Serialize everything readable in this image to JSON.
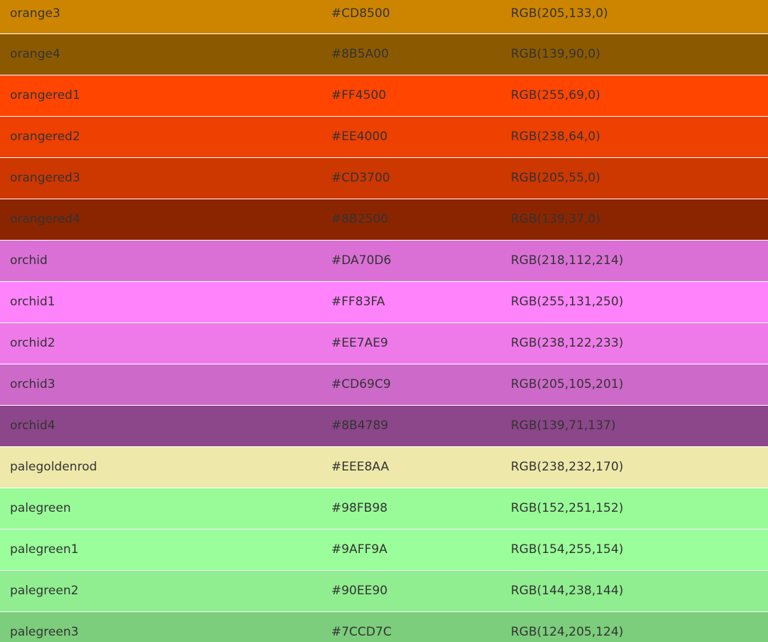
{
  "rows": [
    {
      "name": "orange3",
      "hex": "#CD8500",
      "rgb": "RGB(205,133,0)"
    },
    {
      "name": "orange4",
      "hex": "#8B5A00",
      "rgb": "RGB(139,90,0)"
    },
    {
      "name": "orangered1",
      "hex": "#FF4500",
      "rgb": "RGB(255,69,0)"
    },
    {
      "name": "orangered2",
      "hex": "#EE4000",
      "rgb": "RGB(238,64,0)"
    },
    {
      "name": "orangered3",
      "hex": "#CD3700",
      "rgb": "RGB(205,55,0)"
    },
    {
      "name": "orangered4",
      "hex": "#8B2500",
      "rgb": "RGB(139,37,0)"
    },
    {
      "name": "orchid",
      "hex": "#DA70D6",
      "rgb": "RGB(218,112,214)"
    },
    {
      "name": "orchid1",
      "hex": "#FF83FA",
      "rgb": "RGB(255,131,250)"
    },
    {
      "name": "orchid2",
      "hex": "#EE7AE9",
      "rgb": "RGB(238,122,233)"
    },
    {
      "name": "orchid3",
      "hex": "#CD69C9",
      "rgb": "RGB(205,105,201)"
    },
    {
      "name": "orchid4",
      "hex": "#8B4789",
      "rgb": "RGB(139,71,137)"
    },
    {
      "name": "palegoldenrod",
      "hex": "#EEE8AA",
      "rgb": "RGB(238,232,170)"
    },
    {
      "name": "palegreen",
      "hex": "#98FB98",
      "rgb": "RGB(152,251,152)"
    },
    {
      "name": "palegreen1",
      "hex": "#9AFF9A",
      "rgb": "RGB(154,255,154)"
    },
    {
      "name": "palegreen2",
      "hex": "#90EE90",
      "rgb": "RGB(144,238,144)"
    },
    {
      "name": "palegreen3",
      "hex": "#7CCD7C",
      "rgb": "RGB(124,205,124)"
    }
  ]
}
